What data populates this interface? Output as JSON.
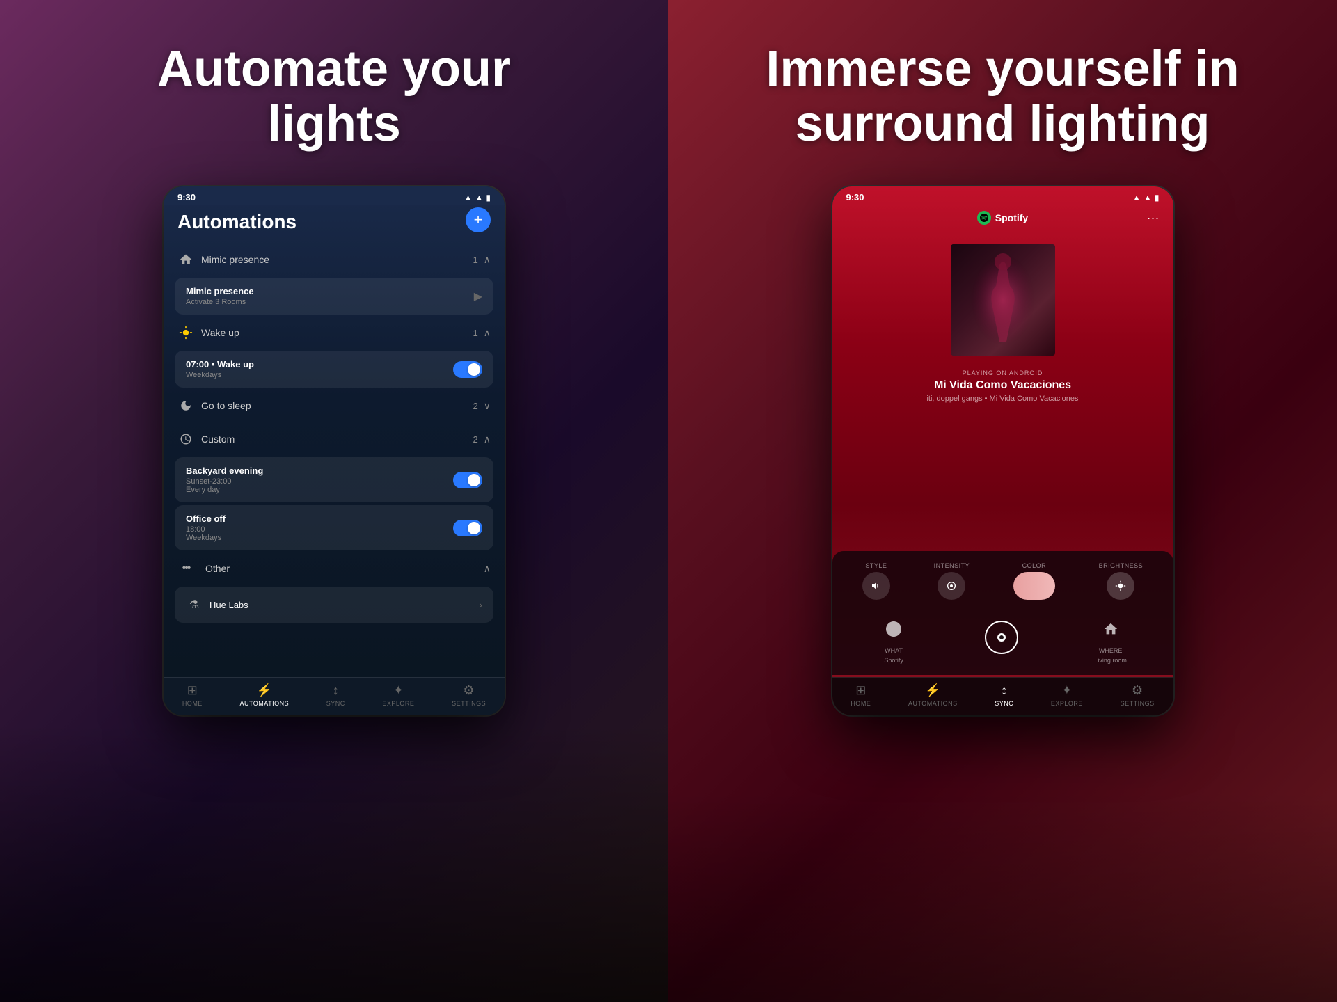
{
  "left": {
    "headline_line1": "Automate your",
    "headline_line2": "lights",
    "tablet": {
      "status_time": "9:30",
      "title": "Automations",
      "add_button": "+",
      "sections": [
        {
          "id": "mimic-presence",
          "icon": "🏠",
          "label": "Mimic presence",
          "count": "1",
          "expanded": true,
          "items": [
            {
              "name": "Mimic presence",
              "detail": "Activate 3 Rooms",
              "type": "arrow",
              "toggle": false
            }
          ]
        },
        {
          "id": "wake-up",
          "icon": "☀️",
          "label": "Wake up",
          "count": "1",
          "expanded": true,
          "items": [
            {
              "name": "07:00 • Wake up",
              "detail": "Weekdays",
              "type": "toggle",
              "toggle": true
            }
          ]
        },
        {
          "id": "go-to-sleep",
          "icon": "🌙",
          "label": "Go to sleep",
          "count": "2",
          "expanded": false,
          "items": []
        },
        {
          "id": "custom",
          "icon": "⏰",
          "label": "Custom",
          "count": "2",
          "expanded": true,
          "items": [
            {
              "name": "Backyard evening",
              "detail": "Sunset-23:00\nEvery day",
              "detail2": "Sunset-23:00",
              "detail3": "Every day",
              "type": "toggle",
              "toggle": true
            },
            {
              "name": "Office off",
              "detail": "18:00\nWeekdays",
              "detail2": "18:00",
              "detail3": "Weekdays",
              "type": "toggle",
              "toggle": true
            }
          ]
        },
        {
          "id": "other",
          "icon": "···",
          "label": "Other",
          "count": "",
          "expanded": true,
          "items": []
        }
      ],
      "hue_labs_label": "Hue Labs",
      "nav": [
        {
          "icon": "⊞",
          "label": "HOME",
          "active": false
        },
        {
          "icon": "⚡",
          "label": "AUTOMATIONS",
          "active": true
        },
        {
          "icon": "↕",
          "label": "SYNC",
          "active": false
        },
        {
          "icon": "✦",
          "label": "EXPLORE",
          "active": false
        },
        {
          "icon": "⚙",
          "label": "SETTINGS",
          "active": false
        }
      ]
    }
  },
  "right": {
    "headline_line1": "Immerse yourself in",
    "headline_line2": "surround lighting",
    "tablet": {
      "status_time": "9:30",
      "app_name": "Spotify",
      "playing_on_label": "PLAYING ON ANDROID",
      "song_title": "Mi Vida Como Vacaciones",
      "song_artist": "iti, doppel gangs • Mi Vida Como Vacaciones",
      "controls": {
        "style_label": "STYLE",
        "intensity_label": "INTENSITY",
        "color_label": "COLOR",
        "brightness_label": "BRIGHTNESS"
      },
      "media_buttons": [
        {
          "label": "WHAT",
          "sub": "Spotify",
          "active": false
        },
        {
          "label": "",
          "sub": "",
          "active": true,
          "is_sync": true
        },
        {
          "label": "WHERE",
          "sub": "Living room",
          "active": false
        }
      ],
      "nav": [
        {
          "icon": "⊞",
          "label": "HOME",
          "active": false
        },
        {
          "icon": "⚡",
          "label": "AUTOMATIONS",
          "active": false
        },
        {
          "icon": "↕",
          "label": "SYNC",
          "active": true
        },
        {
          "icon": "✦",
          "label": "EXPLORE",
          "active": false
        },
        {
          "icon": "⚙",
          "label": "SETTINGS",
          "active": false
        }
      ]
    }
  }
}
